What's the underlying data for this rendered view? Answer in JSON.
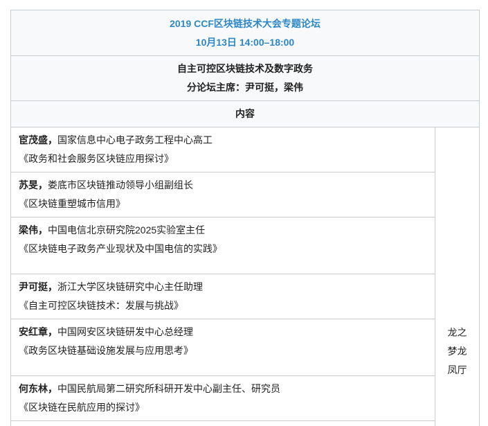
{
  "header": {
    "title": "2019 CCF区块链技术大会专题论坛",
    "datetime": "10月13日 14:00–18:00"
  },
  "forum": {
    "name": "自主可控区块链技术及数字政务",
    "chairs": "分论坛主席：尹可挺，梁伟"
  },
  "content_header": "内容",
  "venue": "龙之梦龙凤厅",
  "talks": [
    {
      "speaker": "宦茂盛，",
      "affiliation": "国家信息中心电子政务工程中心高工",
      "title": "《政务和社会服务区块链应用探讨》"
    },
    {
      "speaker": "苏旻，",
      "affiliation": "娄底市区块链推动领导小组副组长",
      "title": "《区块链重塑城市信用》"
    },
    {
      "speaker": "梁伟，",
      "affiliation": "中国电信北京研究院2025实验室主任",
      "title": "《区块链电子政务产业现状及中国电信的实践》"
    },
    {
      "speaker": "尹可挺，",
      "affiliation": "浙江大学区块链研究中心主任助理",
      "title": "《自主可控区块链技术：发展与挑战》"
    },
    {
      "speaker": "安红章，",
      "affiliation": "中国网安区块链研发中心总经理",
      "title": "《政务区块链基础设施发展与应用思考》"
    },
    {
      "speaker": "何东林，",
      "affiliation": "中国民航局第二研究所科研开发中心副主任、研究员",
      "title": "《区块链在民航应用的探讨》"
    }
  ],
  "colors": {
    "accent": "#2c87c7",
    "border": "#c8ccd1",
    "header_bg": "#f8f9fa",
    "text": "#222222"
  }
}
